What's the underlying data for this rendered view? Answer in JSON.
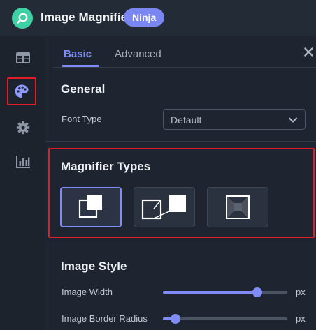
{
  "header": {
    "app_title": "Image Magnifier",
    "badge": "Ninja",
    "logo_icon": "magnifier-icon"
  },
  "sidebar": {
    "items": [
      {
        "icon": "table-icon",
        "active": false
      },
      {
        "icon": "palette-icon",
        "active": true
      },
      {
        "icon": "gear-icon",
        "active": false
      },
      {
        "icon": "bar-chart-icon",
        "active": false
      }
    ]
  },
  "tabs": {
    "items": [
      {
        "label": "Basic",
        "active": true
      },
      {
        "label": "Advanced",
        "active": false
      }
    ],
    "close_icon": "close-icon"
  },
  "general": {
    "title": "General",
    "font_type_label": "Font Type",
    "font_type_value": "Default"
  },
  "magnifier_types": {
    "title": "Magnifier Types",
    "options": [
      {
        "icon": "magnifier-type-overlap-icon",
        "selected": true
      },
      {
        "icon": "magnifier-type-side-icon",
        "selected": false
      },
      {
        "icon": "magnifier-type-inner-icon",
        "selected": false
      }
    ]
  },
  "image_style": {
    "title": "Image Style",
    "fields": [
      {
        "label": "Image Width",
        "unit": "px",
        "level": 0.76
      },
      {
        "label": "Image Border Radius",
        "unit": "px",
        "level": 0.1
      }
    ]
  },
  "colors": {
    "accent": "#7f8cf5",
    "highlight": "#e01e26",
    "logo": "#3fd0a3",
    "badge": "#7a87f2"
  }
}
